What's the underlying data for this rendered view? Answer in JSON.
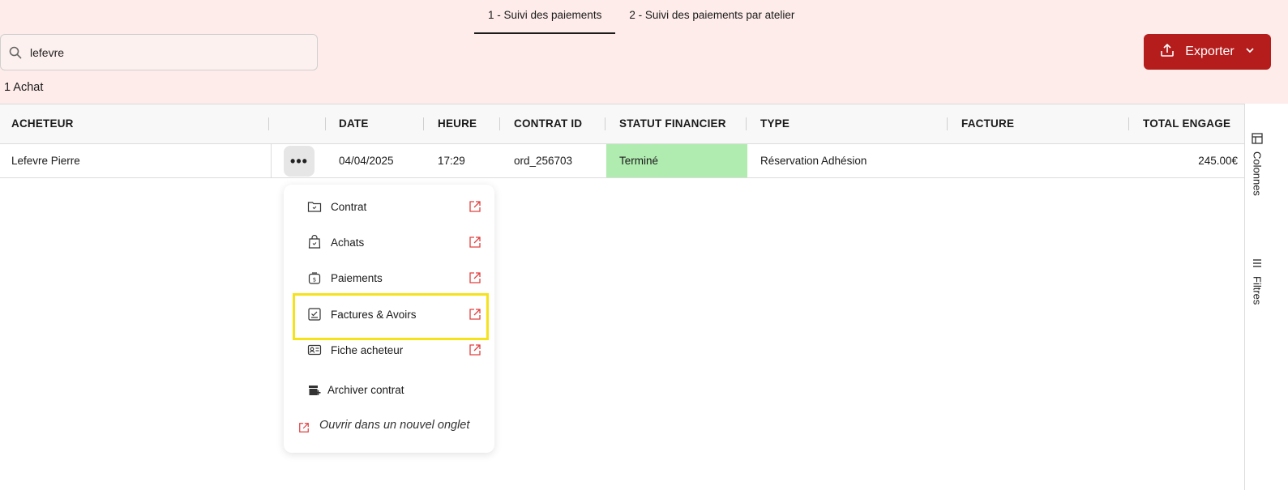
{
  "tabs": [
    {
      "label": "1 - Suivi des paiements",
      "active": true
    },
    {
      "label": "2 - Suivi des paiements par atelier",
      "active": false
    }
  ],
  "search": {
    "value": "lefevre",
    "icon": "search-icon"
  },
  "export_button": {
    "label": "Exporter",
    "icon": "upload-icon"
  },
  "result_count": "1 Achat",
  "table": {
    "columns": [
      "ACHETEUR",
      "DATE",
      "HEURE",
      "CONTRAT ID",
      "STATUT FINANCIER",
      "TYPE",
      "FACTURE",
      "TOTAL ENGAGE"
    ],
    "rows": [
      {
        "acheteur": "Lefevre Pierre",
        "actions": "•••",
        "date": "04/04/2025",
        "heure": "17:29",
        "contrat_id": "ord_256703",
        "statut_financier": "Terminé",
        "type": "Réservation Adhésion",
        "facture": "",
        "total_engage": "245.00€"
      }
    ]
  },
  "side_panel": {
    "columns_label": "Colonnes",
    "filters_label": "Filtres"
  },
  "context_menu": {
    "items": [
      {
        "label": "Contrat",
        "icon": "folder-check-icon"
      },
      {
        "label": "Achats",
        "icon": "bag-check-icon"
      },
      {
        "label": "Paiements",
        "icon": "money-bag-icon"
      },
      {
        "label": "Factures & Avoirs",
        "icon": "invoice-check-icon"
      },
      {
        "label": "Fiche acheteur",
        "icon": "id-card-icon"
      }
    ],
    "archive_label": "Archiver contrat",
    "new_tab_label": "Ouvrir dans un nouvel onglet"
  },
  "colors": {
    "top_background": "#fdecea",
    "accent": "#b51c1c",
    "status_done": "#b0ebb0",
    "highlight": "#f5e21a",
    "link_icon": "#e04040"
  }
}
